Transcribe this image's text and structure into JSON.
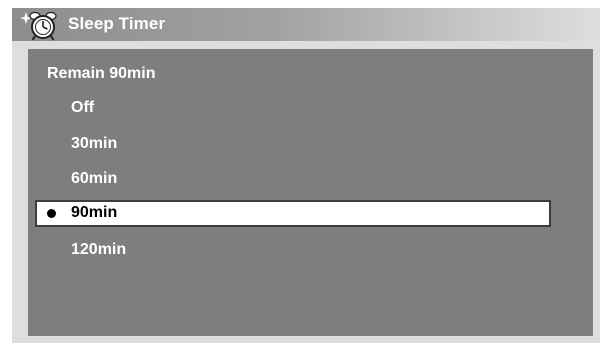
{
  "window": {
    "title": "Sleep Timer",
    "icon": "alarm-clock-icon"
  },
  "sleep_timer": {
    "remain_label": "Remain 90min",
    "selected_index": 3,
    "options": [
      {
        "label": "Off"
      },
      {
        "label": "30min"
      },
      {
        "label": "60min"
      },
      {
        "label": "90min"
      },
      {
        "label": "120min"
      }
    ]
  },
  "colors": {
    "panel_bg": "#7e7e7e",
    "frame_bg": "#dedede",
    "title_text": "#ffffff",
    "selected_bg": "#ffffff"
  }
}
